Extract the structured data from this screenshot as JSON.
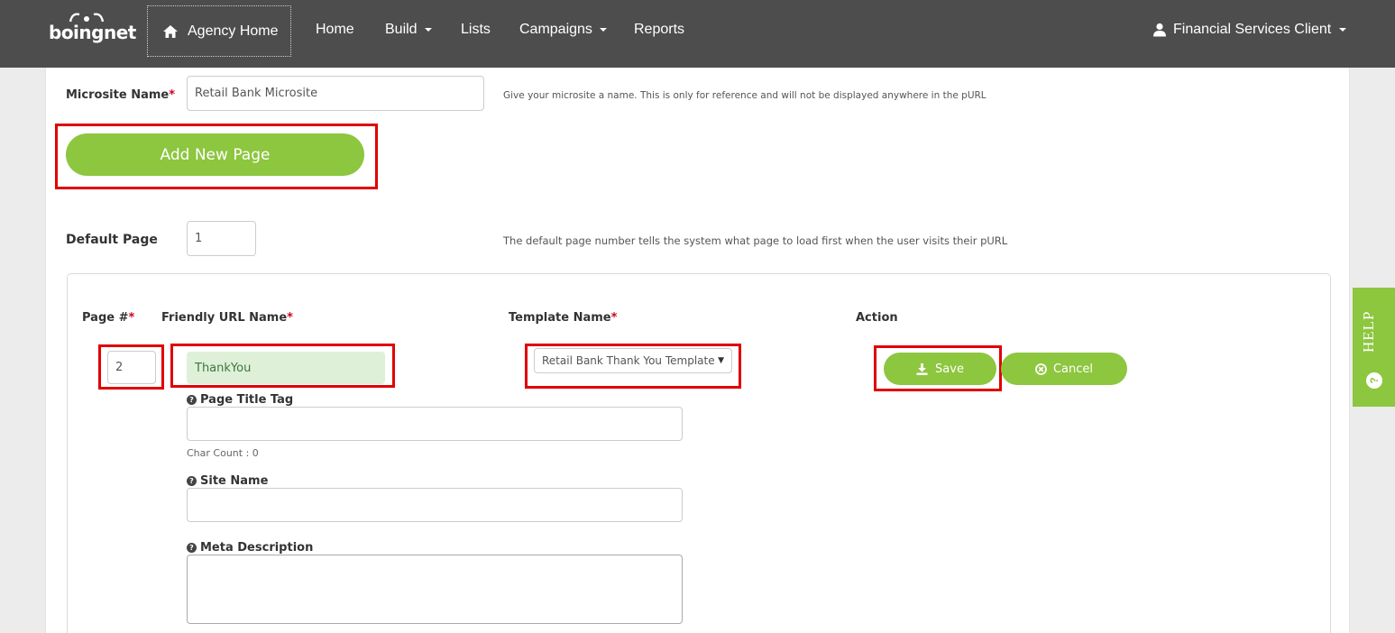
{
  "nav": {
    "logo": "boingnet",
    "agency_home": "Agency Home",
    "items": [
      "Home",
      "Build",
      "Lists",
      "Campaigns",
      "Reports"
    ],
    "user": "Financial Services Client"
  },
  "form": {
    "microsite_label": "Microsite Name",
    "required_mark": "*",
    "microsite_value": "Retail Bank Microsite",
    "microsite_hint": "Give your microsite a name. This is only for reference and will not be displayed anywhere in the pURL",
    "add_page_label": "Add New Page",
    "default_page_label": "Default Page",
    "default_page_value": "1",
    "default_page_hint": "The default page number tells the system what page to load first when the user visits their pURL"
  },
  "page_row": {
    "col_page": "Page #",
    "col_friendly": "Friendly URL Name",
    "col_template": "Template Name",
    "col_action": "Action",
    "page_value": "2",
    "friendly_value": "ThankYou",
    "template_value": "Retail Bank Thank You Template",
    "save_label": "Save",
    "cancel_label": "Cancel",
    "title_tag_label": "Page Title Tag",
    "char_count": "Char Count : 0",
    "site_name_label": "Site Name",
    "meta_desc_label": "Meta Description"
  },
  "help": {
    "label": "HELP",
    "icon": "?"
  },
  "colors": {
    "accent": "#8dc63f",
    "nav_bg": "#4d4d4d",
    "highlight": "#e00000",
    "valid_bg": "#dff0d8"
  }
}
